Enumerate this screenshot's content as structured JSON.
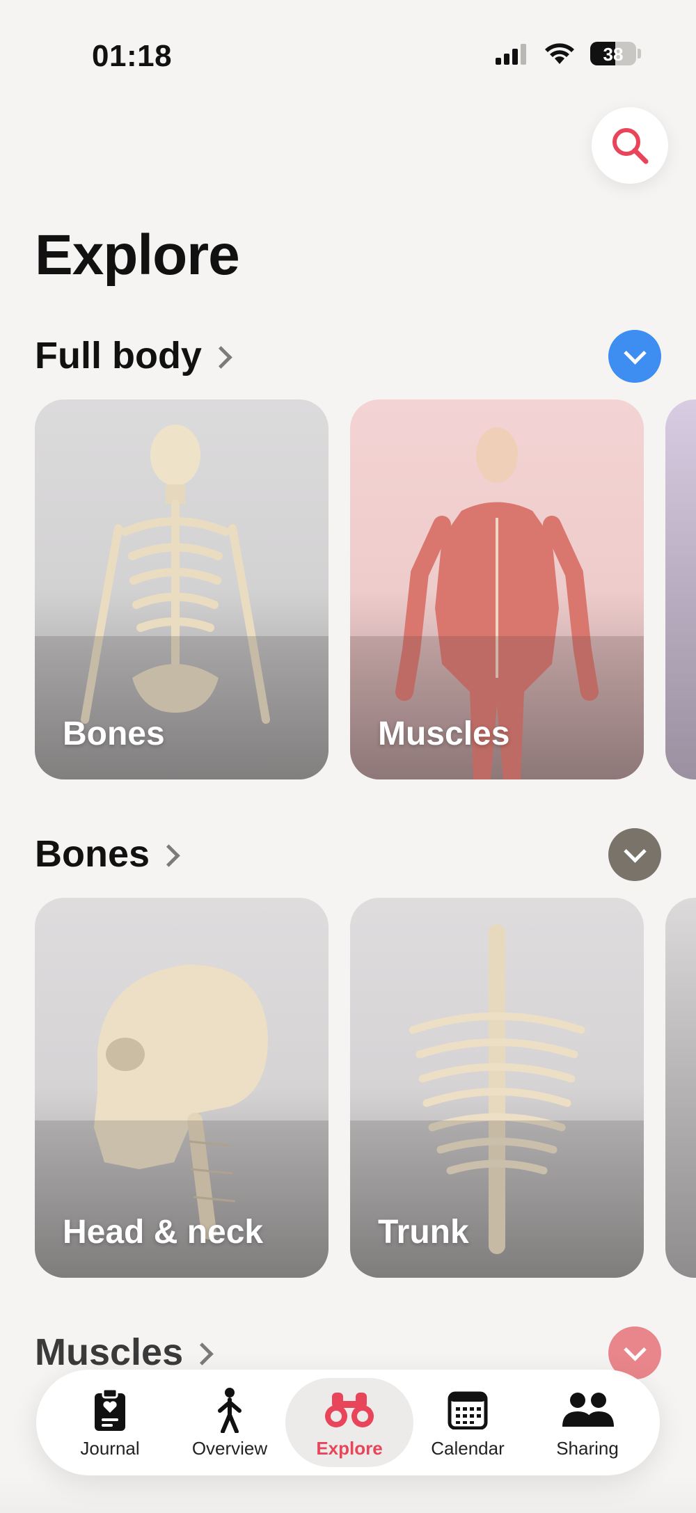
{
  "status": {
    "time": "01:18",
    "battery": "38"
  },
  "header": {
    "title": "Explore"
  },
  "sections": [
    {
      "title": "Full body",
      "toggle_color": "#3d8ef0",
      "cards": [
        {
          "label": "Bones"
        },
        {
          "label": "Muscles"
        }
      ]
    },
    {
      "title": "Bones",
      "toggle_color": "#7a7369",
      "cards": [
        {
          "label": "Head & neck"
        },
        {
          "label": "Trunk"
        }
      ]
    },
    {
      "title": "Muscles",
      "toggle_color": "#e9868b"
    }
  ],
  "tabs": [
    {
      "label": "Journal",
      "icon": "clipboard-heart-icon"
    },
    {
      "label": "Overview",
      "icon": "person-walking-icon"
    },
    {
      "label": "Explore",
      "icon": "binoculars-icon",
      "active": true
    },
    {
      "label": "Calendar",
      "icon": "calendar-icon"
    },
    {
      "label": "Sharing",
      "icon": "people-icon"
    }
  ],
  "colors": {
    "accent": "#e8455a",
    "background": "#f5f4f2"
  }
}
